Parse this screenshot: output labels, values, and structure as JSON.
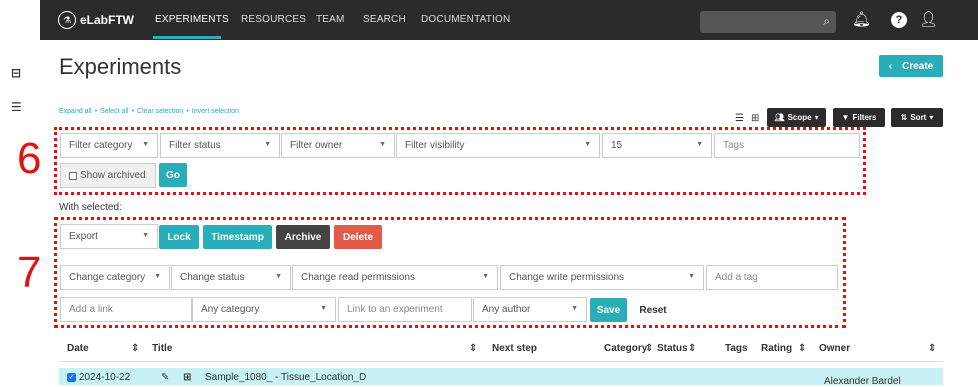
{
  "navbar": {
    "brand": "eLabFTW",
    "links": [
      "EXPERIMENTS",
      "RESOURCES",
      "TEAM",
      "SEARCH",
      "DOCUMENTATION"
    ],
    "accent": "#29aeb9"
  },
  "page": {
    "title": "Experiments",
    "create_label": "Create"
  },
  "selection_links": [
    "Expand all",
    "Select all",
    "Clear selection",
    "Invert selection"
  ],
  "toolbar": {
    "scope": "Scope",
    "filters": "Filters",
    "sort": "Sort"
  },
  "annotations": {
    "six": "6",
    "seven": "7"
  },
  "filters": {
    "category": "Filter category",
    "status": "Filter status",
    "owner": "Filter owner",
    "visibility": "Filter visibility",
    "limit": "15",
    "tags_placeholder": "Tags",
    "show_archived": "Show archived",
    "go": "Go"
  },
  "with_selected": {
    "label": "With selected:",
    "export": "Export",
    "lock": "Lock",
    "timestamp": "Timestamp",
    "archive": "Archive",
    "delete": "Delete",
    "change_category": "Change category",
    "change_status": "Change status",
    "change_read": "Change read permissions",
    "change_write": "Change write permissions",
    "add_tag_placeholder": "Add a tag",
    "add_link_placeholder": "Add a link",
    "any_category": "Any category",
    "link_experiment_placeholder": "Link to an experiment",
    "any_author": "Any author",
    "save": "Save",
    "reset": "Reset"
  },
  "table": {
    "headers": [
      "Date",
      "Title",
      "Next step",
      "Category",
      "Status",
      "Tags",
      "Rating",
      "Owner"
    ],
    "rows": [
      {
        "date": "2024-10-22",
        "title": "Sample_1080_ - Tissue_Location_D",
        "owner": "Alexander Bardel"
      }
    ]
  }
}
